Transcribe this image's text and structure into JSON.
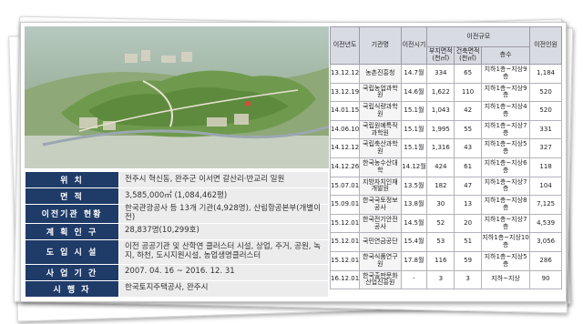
{
  "colors": {
    "label_bg": "#1f3b68",
    "value_bg": "#ececec",
    "header_bg": "#d9dbe3"
  },
  "info": [
    {
      "label": "위 치",
      "value": "전주시 혁신동, 완주군 이서면 갈산리·반교리 일원"
    },
    {
      "label": "면 적",
      "value": "3,585,000㎡ (1,084,462평)"
    },
    {
      "label": "이전기관 현황",
      "value": "한국관광공사 등 13개 기관(4,928명), 산림항공본부(개별이전)"
    },
    {
      "label": "계 획 인 구",
      "value": "28,837명(10,299호)"
    },
    {
      "label": "도 입 시 설",
      "value": "이전 공공기관 및 산학연 클러스터 시설, 상업, 주거, 공원, 녹지, 하천, 도시지원시설, 농업생명클러스터"
    },
    {
      "label": "사 업 기 간",
      "value": "2007. 04. 16 ~ 2016. 12. 31"
    },
    {
      "label": "시 행 자",
      "value": "한국토지주택공사, 완주시"
    }
  ],
  "schedule": {
    "headers": {
      "year": "이전년도",
      "agency": "기관명",
      "time": "이전시기",
      "scale": "이전규모",
      "land": "부지면적 (천㎡)",
      "building": "건축면적 (천㎡)",
      "floors": "층수",
      "staff": "이전인원"
    },
    "rows": [
      {
        "year": "13.12.12",
        "agency": "농촌진흥청",
        "time": "14.7월",
        "land": "334",
        "building": "65",
        "floors": "지하1층~지상9층",
        "staff": "1,184"
      },
      {
        "year": "13.12.19",
        "agency": "국립농업과학원",
        "time": "14.6월",
        "land": "1,622",
        "building": "110",
        "floors": "지하1층~지상9층",
        "staff": "520"
      },
      {
        "year": "14.01.15",
        "agency": "국립식량과학원",
        "time": "15.1월",
        "land": "1,043",
        "building": "42",
        "floors": "지하1층~지상4층",
        "staff": "520"
      },
      {
        "year": "14.06.10",
        "agency": "국립원예특작과학원",
        "time": "15.1월",
        "land": "1,995",
        "building": "55",
        "floors": "지하1층~지상7층",
        "staff": "331"
      },
      {
        "year": "14.12.12",
        "agency": "국립축산과학원",
        "time": "15.1월",
        "land": "1,316",
        "building": "43",
        "floors": "지하1층~지상5층",
        "staff": "327"
      },
      {
        "year": "14.12.26",
        "agency": "한국농수산대학",
        "time": "14.12월",
        "land": "424",
        "building": "61",
        "floors": "지하1층~지상6층",
        "staff": "118"
      },
      {
        "year": "15.07.01",
        "agency": "지방자치인재개발원",
        "time": "13.5월",
        "land": "182",
        "building": "47",
        "floors": "지하1층~지상7층",
        "staff": "104"
      },
      {
        "year": "15.09.01",
        "agency": "한국국토정보공사",
        "time": "13.8월",
        "land": "30",
        "building": "13",
        "floors": "지하1층~지상8층",
        "staff": "7,125"
      },
      {
        "year": "15.12.01",
        "agency": "한국전기안전공사",
        "time": "14.5월",
        "land": "52",
        "building": "20",
        "floors": "지하1층~지상7층",
        "staff": "4,539"
      },
      {
        "year": "15.12.01",
        "agency": "국민연금공단",
        "time": "15.4월",
        "land": "53",
        "building": "51",
        "floors": "지하1층~지상10층",
        "staff": "3,056"
      },
      {
        "year": "15.12.01",
        "agency": "한국식품연구원",
        "time": "17.8월",
        "land": "116",
        "building": "59",
        "floors": "지하1층~지상5층",
        "staff": "286"
      },
      {
        "year": "16.12.01",
        "agency": "한국출판문화산업진흥원",
        "time": "-",
        "land": "3",
        "building": "3",
        "floors": "지하~지상",
        "staff": "90"
      }
    ]
  }
}
